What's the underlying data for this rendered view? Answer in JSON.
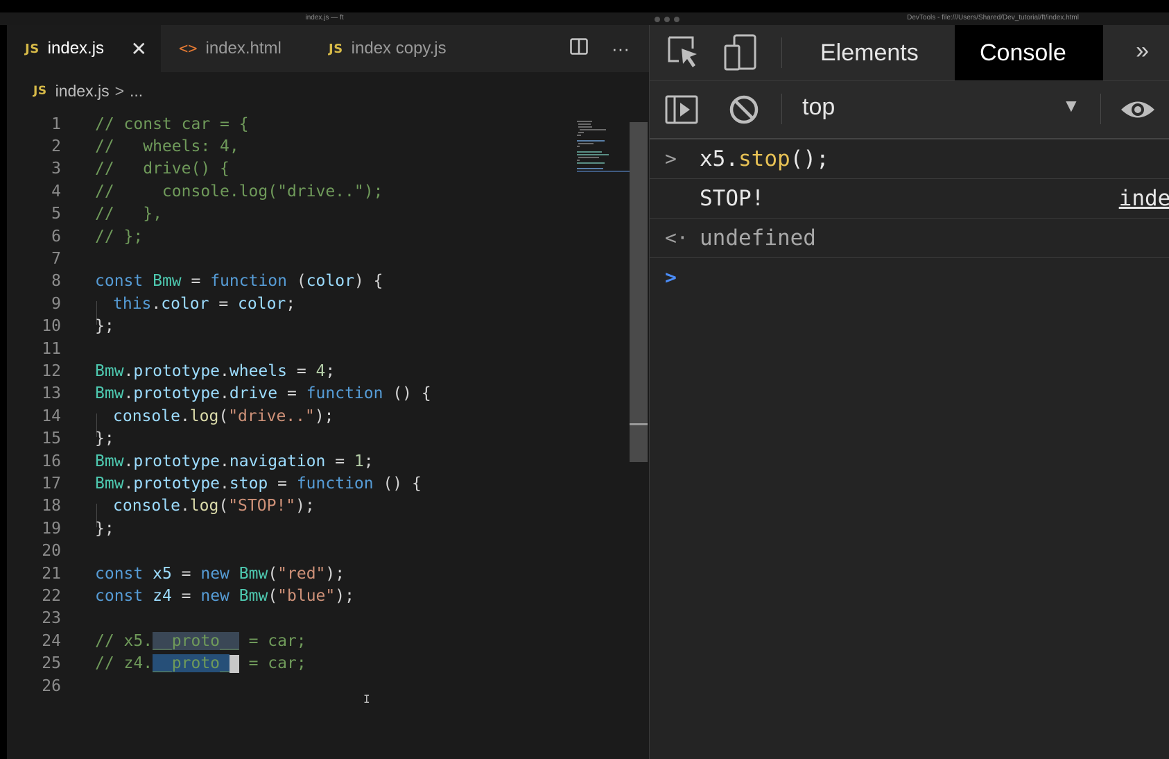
{
  "window": {
    "editor_title": "index.js — ft",
    "devtools_title": "DevTools - file:///Users/Shared/Dev_tutorial/ft/index.html"
  },
  "editor": {
    "tabs": [
      {
        "icon": "JS",
        "label": "index.js",
        "close": "✕"
      },
      {
        "icon": "<>",
        "label": "index.html"
      },
      {
        "icon": "JS",
        "label": "index copy.js"
      }
    ],
    "actions": {
      "split": "split-editor-icon",
      "more": "···"
    },
    "breadcrumb": {
      "icon": "JS",
      "file": "index.js",
      "sep": ">",
      "rest": "..."
    },
    "line_numbers": [
      "1",
      "2",
      "3",
      "4",
      "5",
      "6",
      "7",
      "8",
      "9",
      "10",
      "11",
      "12",
      "13",
      "14",
      "15",
      "16",
      "17",
      "18",
      "19",
      "20",
      "21",
      "22",
      "23",
      "24",
      "25",
      "26"
    ],
    "code": {
      "l1": "// const car = {",
      "l2": "//   wheels: 4,",
      "l3": "//   drive() {",
      "l4": "//     console.log(\"drive..\");",
      "l5": "//   },",
      "l6": "// };",
      "l8": [
        "const",
        " ",
        "Bmw",
        " = ",
        "function",
        " (",
        "color",
        ") {"
      ],
      "l9": [
        "this",
        ".",
        "color",
        " = ",
        "color",
        ";"
      ],
      "l10": "};",
      "l12": [
        "Bmw",
        ".",
        "prototype",
        ".",
        "wheels",
        " = ",
        "4",
        ";"
      ],
      "l13": [
        "Bmw",
        ".",
        "prototype",
        ".",
        "drive",
        " = ",
        "function",
        " () {"
      ],
      "l14": [
        "console",
        ".",
        "log",
        "(",
        "\"drive..\"",
        ");"
      ],
      "l15": "};",
      "l16": [
        "Bmw",
        ".",
        "prototype",
        ".",
        "navigation",
        " = ",
        "1",
        ";"
      ],
      "l17": [
        "Bmw",
        ".",
        "prototype",
        ".",
        "stop",
        " = ",
        "function",
        " () {"
      ],
      "l18": [
        "console",
        ".",
        "log",
        "(",
        "\"STOP!\"",
        ");"
      ],
      "l19": "};",
      "l21": [
        "const",
        " ",
        "x5",
        " = ",
        "new",
        " ",
        "Bmw",
        "(",
        "\"red\"",
        ");"
      ],
      "l22": [
        "const",
        " ",
        "z4",
        " = ",
        "new",
        " ",
        "Bmw",
        "(",
        "\"blue\"",
        ");"
      ],
      "l24": [
        "// x5.",
        "__proto__",
        " = car;"
      ],
      "l25": [
        "// z4.",
        "__proto_",
        "_",
        " = car;"
      ]
    }
  },
  "devtools": {
    "tabs": [
      "Elements",
      "Console"
    ],
    "more": "»",
    "context": "top",
    "console": [
      {
        "prefix": ">",
        "obj": "x5",
        "dot": ".",
        "fn": "stop",
        "rest": "();"
      },
      {
        "text": "STOP!",
        "source": "index"
      },
      {
        "prefix": "<·",
        "text": "undefined"
      },
      {
        "prefix": ">"
      }
    ]
  }
}
